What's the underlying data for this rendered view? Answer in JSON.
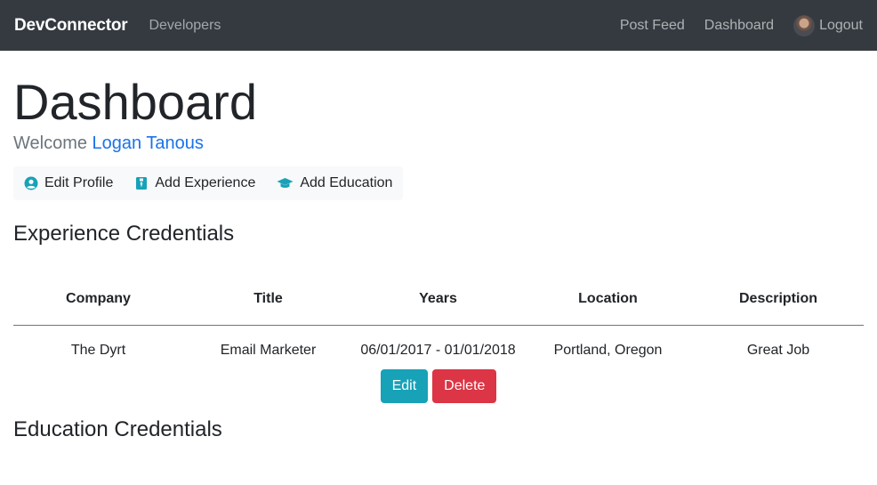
{
  "navbar": {
    "brand": "DevConnector",
    "developers": "Developers",
    "post_feed": "Post Feed",
    "dashboard": "Dashboard",
    "logout": "Logout"
  },
  "page": {
    "title": "Dashboard",
    "welcome_prefix": "Welcome ",
    "user_name": "Logan Tanous"
  },
  "actions": {
    "edit_profile": "Edit Profile",
    "add_experience": "Add Experience",
    "add_education": "Add Education"
  },
  "experience": {
    "heading": "Experience Credentials",
    "columns": [
      "Company",
      "Title",
      "Years",
      "Location",
      "Description"
    ],
    "rows": [
      {
        "company": "The Dyrt",
        "title": "Email Marketer",
        "years": "06/01/2017 - 01/01/2018",
        "location": "Portland, Oregon",
        "description": "Great Job"
      }
    ],
    "edit_label": "Edit",
    "delete_label": "Delete"
  },
  "education": {
    "heading": "Education Credentials"
  },
  "colors": {
    "navbar": "#343a40",
    "accent": "#17a2b8",
    "danger": "#dc3545",
    "link": "#1a73e8"
  }
}
